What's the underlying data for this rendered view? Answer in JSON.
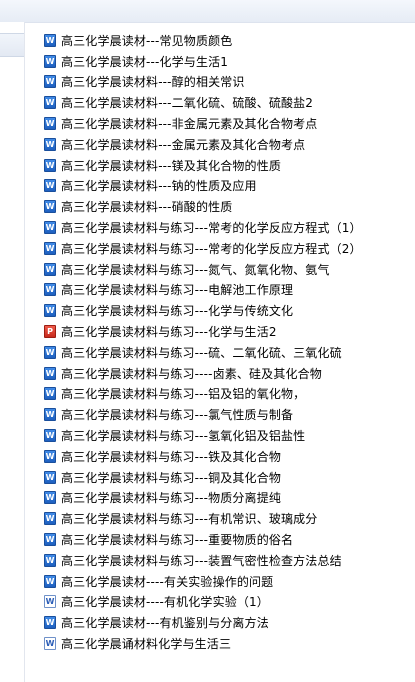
{
  "files": [
    {
      "name": "高三化学晨读材---常见物质颜色",
      "icon": "word-doc-icon"
    },
    {
      "name": "高三化学晨读材---化学与生活1",
      "icon": "word-doc-icon"
    },
    {
      "name": "高三化学晨读材料---醇的相关常识",
      "icon": "word-doc-icon"
    },
    {
      "name": "高三化学晨读材料---二氧化硫、硫酸、硫酸盐2",
      "icon": "word-doc-icon"
    },
    {
      "name": "高三化学晨读材料---非金属元素及其化合物考点",
      "icon": "word-doc-icon"
    },
    {
      "name": "高三化学晨读材料---金属元素及其化合物考点",
      "icon": "word-doc-icon"
    },
    {
      "name": "高三化学晨读材料---镁及其化合物的性质",
      "icon": "word-doc-icon"
    },
    {
      "name": "高三化学晨读材料---钠的性质及应用",
      "icon": "word-doc-icon"
    },
    {
      "name": "高三化学晨读材料---硝酸的性质",
      "icon": "word-doc-icon"
    },
    {
      "name": "高三化学晨读材料与练习---常考的化学反应方程式（1）",
      "icon": "word-doc-icon"
    },
    {
      "name": "高三化学晨读材料与练习---常考的化学反应方程式（2）",
      "icon": "word-doc-icon"
    },
    {
      "name": "高三化学晨读材料与练习---氮气、氮氧化物、氨气",
      "icon": "word-doc-icon"
    },
    {
      "name": "高三化学晨读材料与练习---电解池工作原理",
      "icon": "word-doc-icon"
    },
    {
      "name": "高三化学晨读材料与练习---化学与传统文化",
      "icon": "word-doc-icon"
    },
    {
      "name": "高三化学晨读材料与练习---化学与生活2",
      "icon": "pdf-icon"
    },
    {
      "name": "高三化学晨读材料与练习---硫、二氧化硫、三氧化硫",
      "icon": "word-doc-icon"
    },
    {
      "name": "高三化学晨读材料与练习----卤素、硅及其化合物",
      "icon": "word-doc-icon"
    },
    {
      "name": "高三化学晨读材料与练习---铝及铝的氧化物，",
      "icon": "word-doc-icon"
    },
    {
      "name": "高三化学晨读材料与练习---氯气性质与制备",
      "icon": "word-doc-icon"
    },
    {
      "name": "高三化学晨读材料与练习---氢氧化铝及铝盐性",
      "icon": "word-doc-icon"
    },
    {
      "name": "高三化学晨读材料与练习---铁及其化合物",
      "icon": "word-doc-icon"
    },
    {
      "name": "高三化学晨读材料与练习---铜及其化合物",
      "icon": "word-doc-icon"
    },
    {
      "name": "高三化学晨读材料与练习---物质分离提纯",
      "icon": "word-doc-icon"
    },
    {
      "name": "高三化学晨读材料与练习---有机常识、玻璃成分",
      "icon": "word-doc-icon"
    },
    {
      "name": "高三化学晨读材料与练习---重要物质的俗名",
      "icon": "word-doc-icon"
    },
    {
      "name": "高三化学晨读材料与练习---装置气密性检查方法总结",
      "icon": "word-doc-icon"
    },
    {
      "name": "高三化学晨读材----有关实验操作的问题",
      "icon": "word-doc-icon"
    },
    {
      "name": "高三化学晨读材----有机化学实验（1）",
      "icon": "word-old-doc-icon"
    },
    {
      "name": "高三化学晨读材---有机鉴别与分离方法",
      "icon": "word-doc-icon"
    },
    {
      "name": "高三化学晨诵材料化学与生活三",
      "icon": "word-old-doc-icon"
    }
  ]
}
